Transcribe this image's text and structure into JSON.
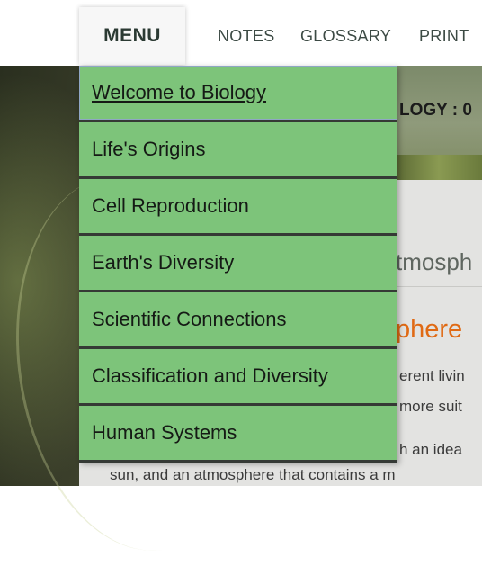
{
  "nav": {
    "menu_label": "MENU",
    "links": [
      "NOTES",
      "GLOSSARY",
      "PRINT"
    ]
  },
  "background": {
    "course_title_fragment": "LOGY : 0",
    "heading_fragment": "tmosph",
    "subheading_fragment": "phere",
    "text_lines": [
      "erent livin",
      "more suit",
      "h an idea",
      "sun, and an atmosphere that contains a m"
    ]
  },
  "dropdown": {
    "items": [
      "Welcome to Biology",
      "Life's Origins",
      "Cell Reproduction",
      "Earth's Diversity",
      "Scientific Connections",
      "Classification and Diversity",
      "Human Systems"
    ]
  },
  "colors": {
    "menu_item_bg": "#7dc47a",
    "accent_heading": "#e06a14"
  }
}
